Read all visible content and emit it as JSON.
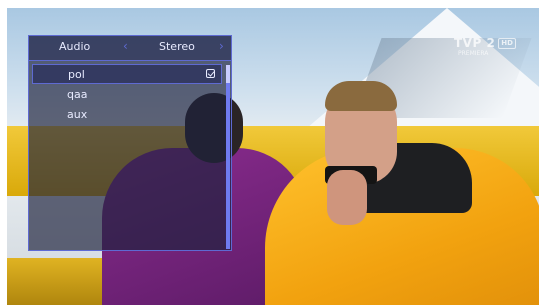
{
  "channel_logo": {
    "name": "TVP 2",
    "badge": "HD",
    "subtitle": "PREMIERA"
  },
  "audio_panel": {
    "title": "Audio",
    "mode": "Stereo",
    "tracks": [
      {
        "label": "pol",
        "selected": true
      },
      {
        "label": "qaa",
        "selected": false
      },
      {
        "label": "aux",
        "selected": false
      }
    ],
    "icons": {
      "prev": "chevron-left-icon",
      "next": "chevron-right-icon",
      "selected": "checkbox-checked-icon"
    },
    "accent_color": "#5e6ad2"
  }
}
